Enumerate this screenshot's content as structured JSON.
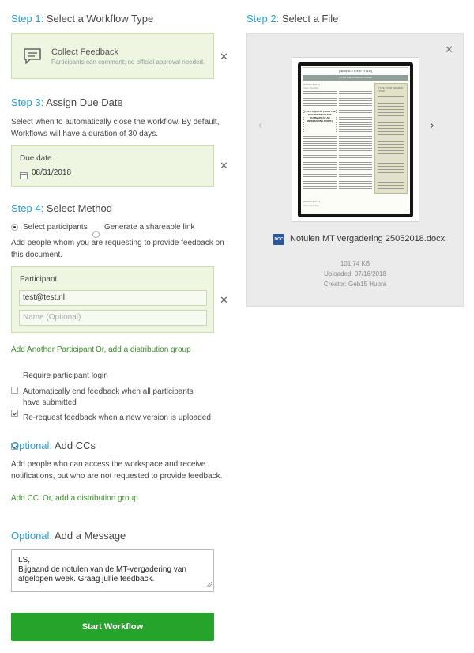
{
  "step1": {
    "prefix": "Step 1:",
    "title": "Select a Workflow Type",
    "workflow": {
      "name": "Collect Feedback",
      "description": "Participants can comment; no official approval needed.",
      "icon": "comment-icon"
    }
  },
  "step2": {
    "prefix": "Step 2:",
    "title": "Select a File",
    "file": {
      "type_badge": "DOC",
      "name": "Notulen MT vergadering 25052018.docx",
      "size": "101.74 KB",
      "uploaded": "Uploaded: 07/16/2018",
      "creator": "Creator: Geb15 Hupra"
    },
    "preview": {
      "newsletter_title": "[NEWSLETTER TITLE]",
      "newsletter_sub": "[TYPE THE COMPANY NAME]",
      "story_title": "[STORY TITLE]",
      "story_sub": "[Story Subtitle]",
      "sidebar_title": "[TYPE YOUR SIDEBAR TITLE]",
      "pull_quote": "[TYPE A QUOTE FROM THE DOCUMENT OR THE SUMMARY OF AN INTERESTING POINT.]",
      "story2_title": "[STORY TITLE]",
      "story2_sub": "[Story Subtitle]"
    }
  },
  "step3": {
    "prefix": "Step 3:",
    "title": "Assign Due Date",
    "description": "Select when to automatically close the workflow. By default, Workflows will have a duration of 30 days.",
    "due_label": "Due date",
    "due_value": "08/31/2018"
  },
  "step4": {
    "prefix": "Step 4:",
    "title": "Select Method",
    "method_options": [
      "Select participants",
      "Generate a shareable link"
    ],
    "description": "Add people whom you are requesting to provide feedback on this document.",
    "participant_label": "Participant",
    "participant_email": "test@test.nl",
    "participant_name_placeholder": "Name (Optional)",
    "add_participant": "Add Another Participant",
    "add_group": "Or, add a distribution group",
    "options": [
      {
        "label": "Require participant login",
        "checked": false
      },
      {
        "label": "Automatically end feedback when all participants have submitted",
        "checked": true
      },
      {
        "label": "Re-request feedback when a new version is uploaded",
        "checked": true
      }
    ]
  },
  "ccs": {
    "prefix": "Optional:",
    "title": "Add CCs",
    "description": "Add people who can access the workspace and receive notifications, but who are not requested to provide feedback.",
    "add_cc": "Add CC",
    "add_group": "Or, add a distribution group"
  },
  "message": {
    "prefix": "Optional:",
    "title": "Add a Message",
    "text_line1": "LS,",
    "text_line2": "Bijgaand de notulen van de MT-vergadering van afgelopen week. Graag jullie feedback."
  },
  "start_button": "Start Workflow",
  "colors": {
    "accent_blue": "#2a9fd6",
    "green_button": "#26a32a",
    "panel_green": "#eef6e2",
    "link_green": "#3d8b2a"
  }
}
